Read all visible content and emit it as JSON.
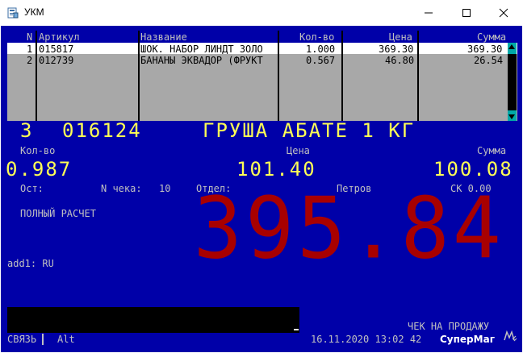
{
  "window": {
    "title": "УКМ"
  },
  "table": {
    "headers": [
      "N",
      "Артикул",
      "Название",
      "Кол-во",
      "Цена",
      "Сумма"
    ],
    "rows": [
      {
        "n": "1",
        "article": "015817",
        "name": "ШОК. НАБОР ЛИНДТ ЗОЛО",
        "qty": "1.000",
        "price": "369.30",
        "sum": "369.30"
      },
      {
        "n": "2",
        "article": "012739",
        "name": "БАНАНЫ ЭКВАДОР (ФРУКТ",
        "qty": "0.567",
        "price": "46.80",
        "sum": "26.54"
      }
    ]
  },
  "current": {
    "position": "3",
    "article": "016124",
    "name": "ГРУША АБАТЕ 1 КГ",
    "qty_label": "Кол-во",
    "qty": "0.987",
    "price_label": "Цена",
    "price": "101.40",
    "sum_label": "Сумма",
    "sum": "100.08"
  },
  "info": {
    "stock_label": "Ост:",
    "check_label": "N чека:",
    "check_number": "10",
    "dept_label": "Отдел:",
    "cashier": "Петров",
    "discount": "СК 0.00",
    "payment_mode": "ПОЛНЫЙ РАСЧЕТ",
    "add1": "add1: RU"
  },
  "total": "395.84",
  "status": {
    "mode": "ЧЕК НА ПРОДАЖУ",
    "connection": "СВЯЗЬ",
    "alt": "Alt",
    "datetime": "16.11.2020 13:02 42",
    "brand": "СуперМаг"
  },
  "colors": {
    "background": "#0000a8",
    "total": "#a80000",
    "accent": "#ffff55",
    "scrollbar": "#00a8a8"
  }
}
